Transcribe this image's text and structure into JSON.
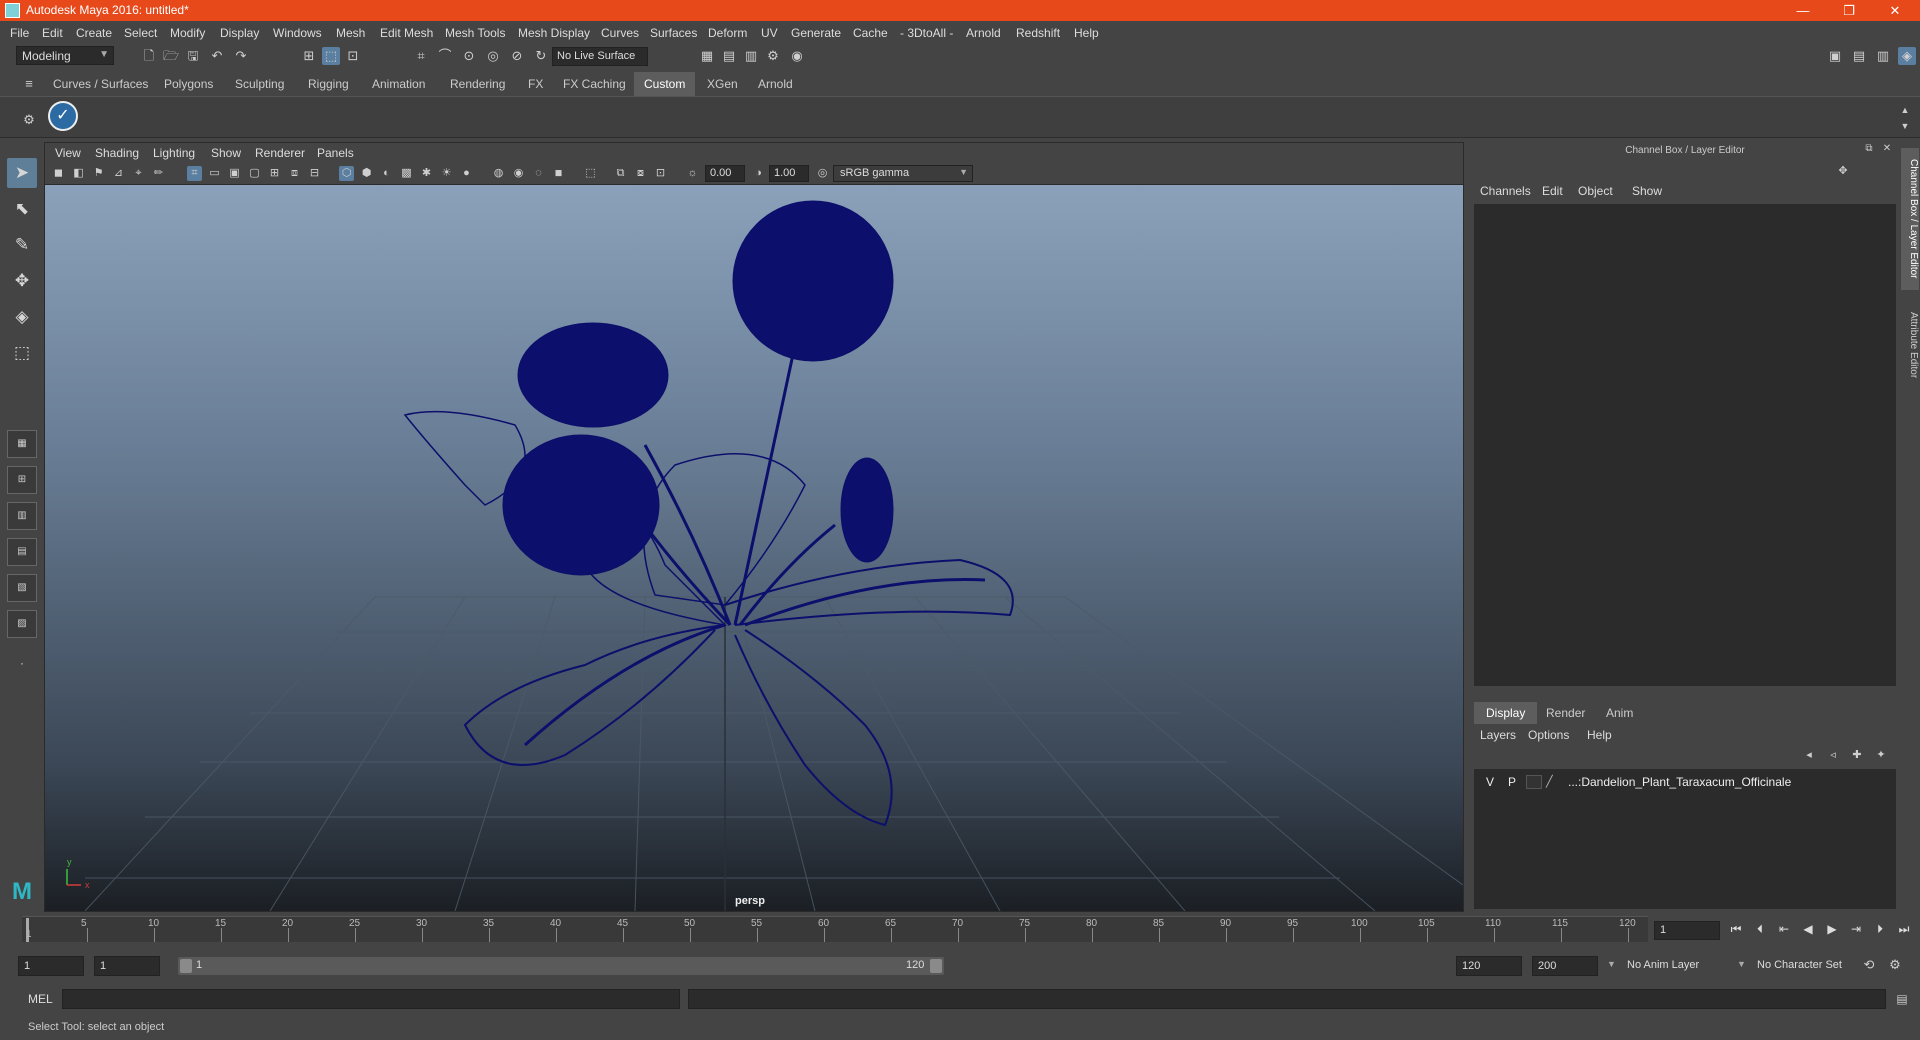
{
  "window": {
    "title": "Autodesk Maya 2016: untitled*",
    "minimize_glyph": "—",
    "restore_glyph": "❐",
    "close_glyph": "✕"
  },
  "menus": [
    "File",
    "Edit",
    "Create",
    "Select",
    "Modify",
    "Display",
    "Windows",
    "Mesh",
    "Edit Mesh",
    "Mesh Tools",
    "Mesh Display",
    "Curves",
    "Surfaces",
    "Deform",
    "UV",
    "Generate",
    "Cache",
    "- 3DtoAll -",
    "Arnold",
    "Redshift",
    "Help"
  ],
  "status_line": {
    "mode": "Modeling",
    "live_surface": "No Live Surface"
  },
  "shelf": {
    "tabs": [
      "Curves / Surfaces",
      "Polygons",
      "Sculpting",
      "Rigging",
      "Animation",
      "Rendering",
      "FX",
      "FX Caching",
      "Custom",
      "XGen",
      "Arnold"
    ],
    "active_tab": "Custom"
  },
  "viewport": {
    "menus": [
      "View",
      "Shading",
      "Lighting",
      "Show",
      "Renderer",
      "Panels"
    ],
    "exposure": "0.00",
    "gamma": "1.00",
    "color_space": "sRGB gamma",
    "camera_label": "persp",
    "axis_y": "y",
    "axis_x": "x"
  },
  "channel_box": {
    "title": "Channel Box / Layer Editor",
    "menus": [
      "Channels",
      "Edit",
      "Object",
      "Show"
    ]
  },
  "layer_editor": {
    "tabs": [
      "Display",
      "Render",
      "Anim"
    ],
    "active_tab": "Display",
    "menus": [
      "Layers",
      "Options",
      "Help"
    ],
    "layers": [
      {
        "visible": "V",
        "playback": "P",
        "name": "...:Dandelion_Plant_Taraxacum_Officinale"
      }
    ]
  },
  "side_tabs": [
    "Channel Box / Layer Editor",
    "Attribute Editor"
  ],
  "time_slider": {
    "ticks": [
      "5",
      "10",
      "15",
      "20",
      "25",
      "30",
      "35",
      "40",
      "45",
      "50",
      "55",
      "60",
      "65",
      "70",
      "75",
      "80",
      "85",
      "90",
      "95",
      "100",
      "105",
      "110",
      "115",
      "120"
    ],
    "start_frame_label": "1",
    "current_frame": "1"
  },
  "range_slider": {
    "start_time": "1",
    "playback_start": "1",
    "range_start": "1",
    "range_end": "120",
    "playback_end": "120",
    "end_time": "200",
    "anim_layer": "No Anim Layer",
    "character_set": "No Character Set"
  },
  "command_line": {
    "language": "MEL"
  },
  "help_line": {
    "text": "Select Tool: select an object"
  },
  "colors": {
    "titlebar": "#e8491b",
    "wireframe": "#0c0f6b",
    "accent": "#5a7fa0"
  }
}
